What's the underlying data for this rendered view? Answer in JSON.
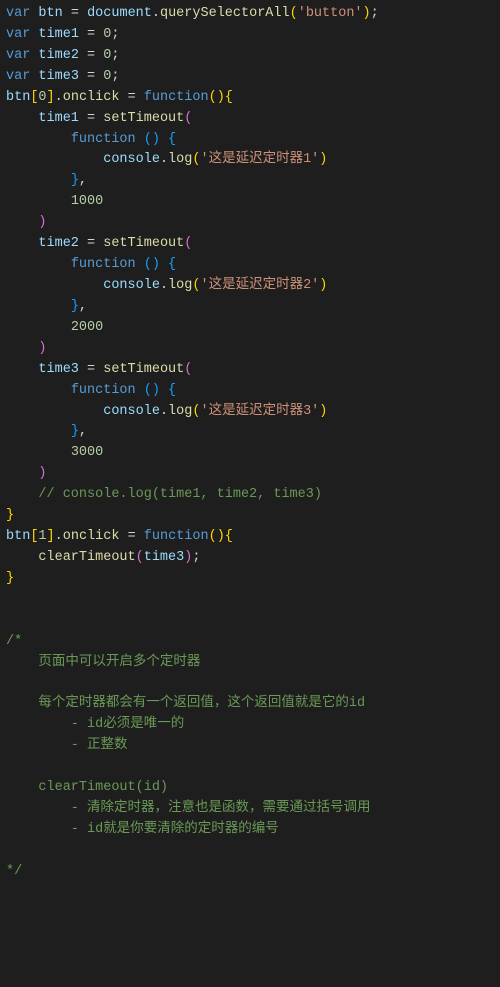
{
  "code": {
    "declares": [
      {
        "kw": "var",
        "name": "btn",
        "assign": "document.querySelectorAll",
        "arg": "'button'"
      },
      {
        "kw": "var",
        "name": "time1",
        "val": "0"
      },
      {
        "kw": "var",
        "name": "time2",
        "val": "0"
      },
      {
        "kw": "var",
        "name": "time3",
        "val": "0"
      }
    ],
    "onclick0": {
      "target": "btn",
      "idx": "0",
      "prop": "onclick",
      "fn": "function",
      "timers": [
        {
          "name": "time1",
          "call": "setTimeout",
          "inner": "function",
          "console": "console",
          "log": "log",
          "msg": "'这是延迟定时器1'",
          "delay": "1000"
        },
        {
          "name": "time2",
          "call": "setTimeout",
          "inner": "function",
          "console": "console",
          "log": "log",
          "msg": "'这是延迟定时器2'",
          "delay": "2000"
        },
        {
          "name": "time3",
          "call": "setTimeout",
          "inner": "function",
          "console": "console",
          "log": "log",
          "msg": "'这是延迟定时器3'",
          "delay": "3000"
        }
      ],
      "commentLine": "// console.log(time1, time2, time3)"
    },
    "onclick1": {
      "target": "btn",
      "idx": "1",
      "prop": "onclick",
      "fn": "function",
      "clear": "clearTimeout",
      "arg": "time3"
    },
    "blockComment": {
      "open": "/*",
      "lines": [
        "    页面中可以开启多个定时器",
        "",
        "    每个定时器都会有一个返回值，这个返回值就是它的id",
        "        - id必须是唯一的",
        "        - 正整数",
        "",
        "    clearTimeout(id)",
        "        - 清除定时器，注意也是函数，需要通过括号调用",
        "        - id就是你要清除的定时器的编号",
        ""
      ],
      "close": "*/"
    }
  }
}
